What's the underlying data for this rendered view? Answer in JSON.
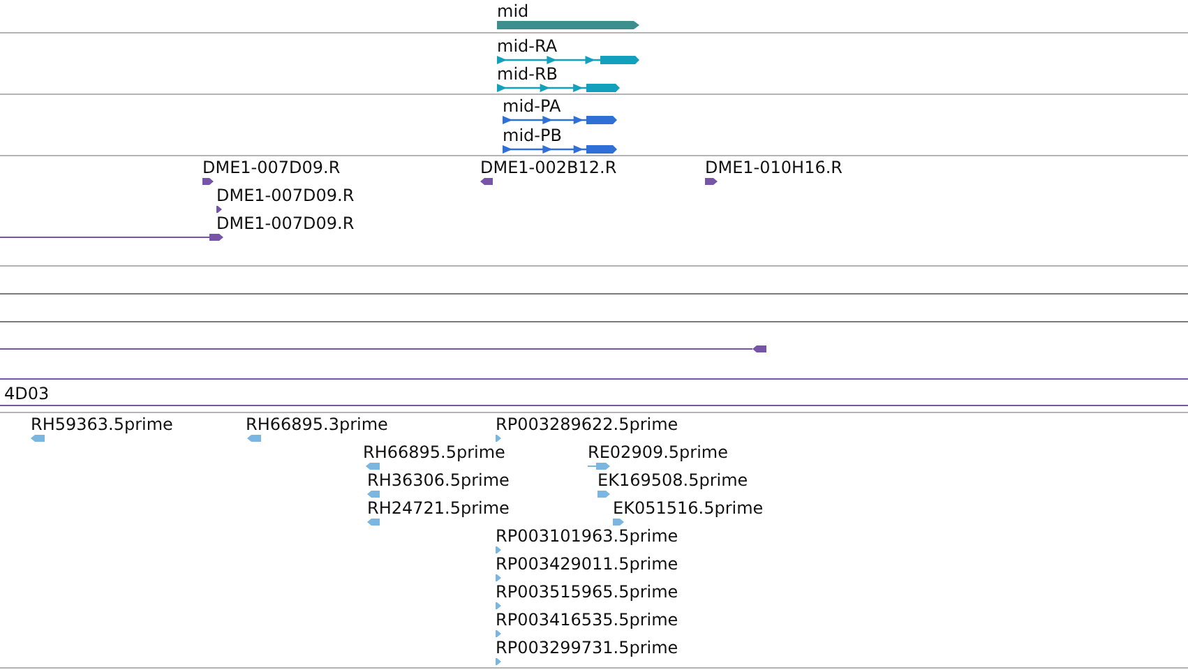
{
  "tracks": [
    {
      "color": "#3d8f8f",
      "features": [
        {
          "kind": "gene",
          "label": "mid",
          "reverse": false
        }
      ]
    },
    {
      "color": "#13a0bd",
      "features": [
        {
          "kind": "transcript",
          "label": "mid-RA",
          "reverse": false
        },
        {
          "kind": "transcript",
          "label": "mid-RB",
          "reverse": false
        }
      ]
    },
    {
      "color": "#2f6fd6",
      "features": [
        {
          "kind": "transcript",
          "label": "mid-PA",
          "reverse": false
        },
        {
          "kind": "transcript",
          "label": "mid-PB",
          "reverse": false
        }
      ]
    },
    {
      "color": "#7654a8",
      "features": [
        {
          "kind": "est",
          "label": "DME1-007D09.R",
          "reverse": false
        },
        {
          "kind": "est",
          "label": "DME1-007D09.R",
          "reverse": false
        },
        {
          "kind": "est",
          "label": "DME1-007D09.R",
          "reverse": false
        },
        {
          "kind": "est",
          "label": "DME1-002B12.R",
          "reverse": true
        },
        {
          "kind": "est",
          "label": "DME1-010H16.R",
          "reverse": false
        }
      ]
    },
    {
      "color": "#7654a8",
      "features": [
        {
          "kind": "est",
          "reverse": true
        },
        {
          "kind": "clone",
          "label": "4D03"
        }
      ]
    },
    {
      "color": "#7bb6e0",
      "features": [
        {
          "kind": "est",
          "label": "RH59363.5prime",
          "reverse": true
        },
        {
          "kind": "est",
          "label": "RH66895.3prime",
          "reverse": true
        },
        {
          "kind": "est",
          "label": "RP003289622.5prime",
          "reverse": false
        },
        {
          "kind": "est",
          "label": "RH66895.5prime",
          "reverse": true
        },
        {
          "kind": "est",
          "label": "RE02909.5prime",
          "reverse": false
        },
        {
          "kind": "est",
          "label": "RH36306.5prime",
          "reverse": true
        },
        {
          "kind": "est",
          "label": "EK169508.5prime",
          "reverse": false
        },
        {
          "kind": "est",
          "label": "RH24721.5prime",
          "reverse": true
        },
        {
          "kind": "est",
          "label": "EK051516.5prime",
          "reverse": false
        },
        {
          "kind": "est",
          "label": "RP003101963.5prime",
          "reverse": false
        },
        {
          "kind": "est",
          "label": "RP003429011.5prime",
          "reverse": false
        },
        {
          "kind": "est",
          "label": "RP003515965.5prime",
          "reverse": false
        },
        {
          "kind": "est",
          "label": "RP003416535.5prime",
          "reverse": false
        },
        {
          "kind": "est",
          "label": "RP003299731.5prime",
          "reverse": false
        }
      ]
    }
  ]
}
